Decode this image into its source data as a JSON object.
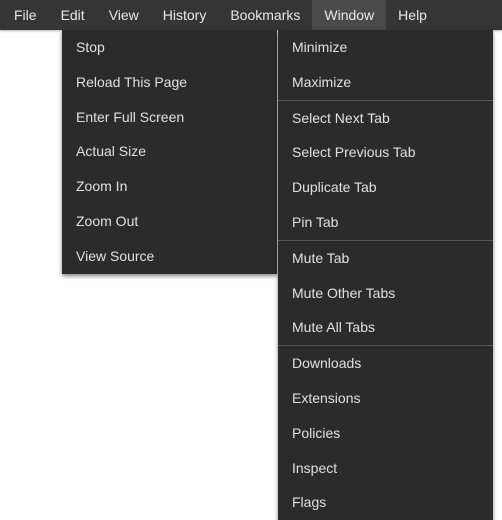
{
  "menubar": {
    "items": [
      {
        "label": "File"
      },
      {
        "label": "Edit"
      },
      {
        "label": "View"
      },
      {
        "label": "History"
      },
      {
        "label": "Bookmarks"
      },
      {
        "label": "Window"
      },
      {
        "label": "Help"
      }
    ],
    "active_index": 5
  },
  "dropdown_left": {
    "items": [
      "Stop",
      "Reload This Page",
      "Enter Full Screen",
      "Actual Size",
      "Zoom In",
      "Zoom Out",
      "View Source"
    ]
  },
  "dropdown_right": {
    "groups": [
      [
        "Minimize",
        "Maximize"
      ],
      [
        "Select Next Tab",
        "Select Previous Tab",
        "Duplicate Tab",
        "Pin Tab"
      ],
      [
        "Mute Tab",
        "Mute Other Tabs",
        "Mute All Tabs"
      ],
      [
        "Downloads",
        "Extensions",
        "Policies",
        "Inspect",
        "Flags"
      ]
    ]
  }
}
